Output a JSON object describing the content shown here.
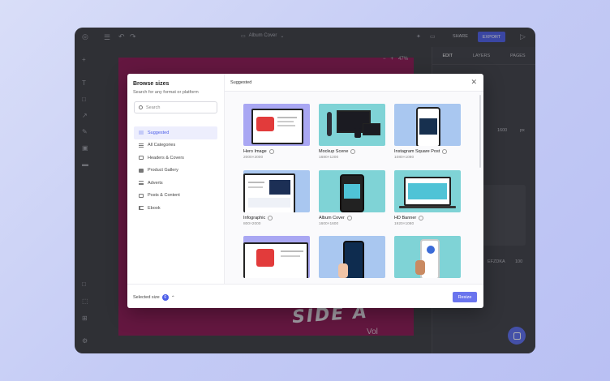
{
  "editor": {
    "doc_title": "Album Cover",
    "share_label": "SHARE",
    "export_label": "EXPORT",
    "zoom_value": "47%",
    "right_tabs": [
      "EDIT",
      "LAYERS",
      "PAGES"
    ],
    "width_value": "1600",
    "width_unit": "px",
    "canvas_text": "SIDE A",
    "canvas_text_small": "Vol",
    "panel_label_a": "EFZDKA",
    "panel_label_b": "100"
  },
  "modal": {
    "title": "Browse sizes",
    "subtitle": "Search for any format or platform",
    "search_placeholder": "Search",
    "header_label": "Suggested",
    "categories": [
      {
        "label": "Suggested",
        "icon": "grid-icon"
      },
      {
        "label": "All Categories",
        "icon": "list-icon"
      },
      {
        "label": "Headers & Covers",
        "icon": "header-icon"
      },
      {
        "label": "Product Gallery",
        "icon": "camera-icon"
      },
      {
        "label": "Adverts",
        "icon": "megaphone-icon"
      },
      {
        "label": "Posts & Content",
        "icon": "post-icon"
      },
      {
        "label": "Ebook",
        "icon": "book-icon"
      }
    ],
    "cards": [
      {
        "name": "Hero Image",
        "size": "2000×2000"
      },
      {
        "name": "Mockup Scene",
        "size": "1680×1200"
      },
      {
        "name": "Instagram Square Post",
        "size": "1080×1080"
      },
      {
        "name": "Infographic",
        "size": "800×2000"
      },
      {
        "name": "Album Cover",
        "size": "1600×1600"
      },
      {
        "name": "HD Banner",
        "size": "1920×1080"
      },
      {
        "name": "",
        "size": ""
      },
      {
        "name": "",
        "size": ""
      },
      {
        "name": "",
        "size": ""
      }
    ],
    "selected_label": "Selected size",
    "selected_count": "0",
    "resize_label": "Resize"
  },
  "colors": {
    "accent": "#4b5de8",
    "canvas": "#8b1550",
    "thumb_purple": "#a9a7f3",
    "thumb_teal": "#7fd3d6",
    "thumb_blue": "#a9c7f0"
  }
}
